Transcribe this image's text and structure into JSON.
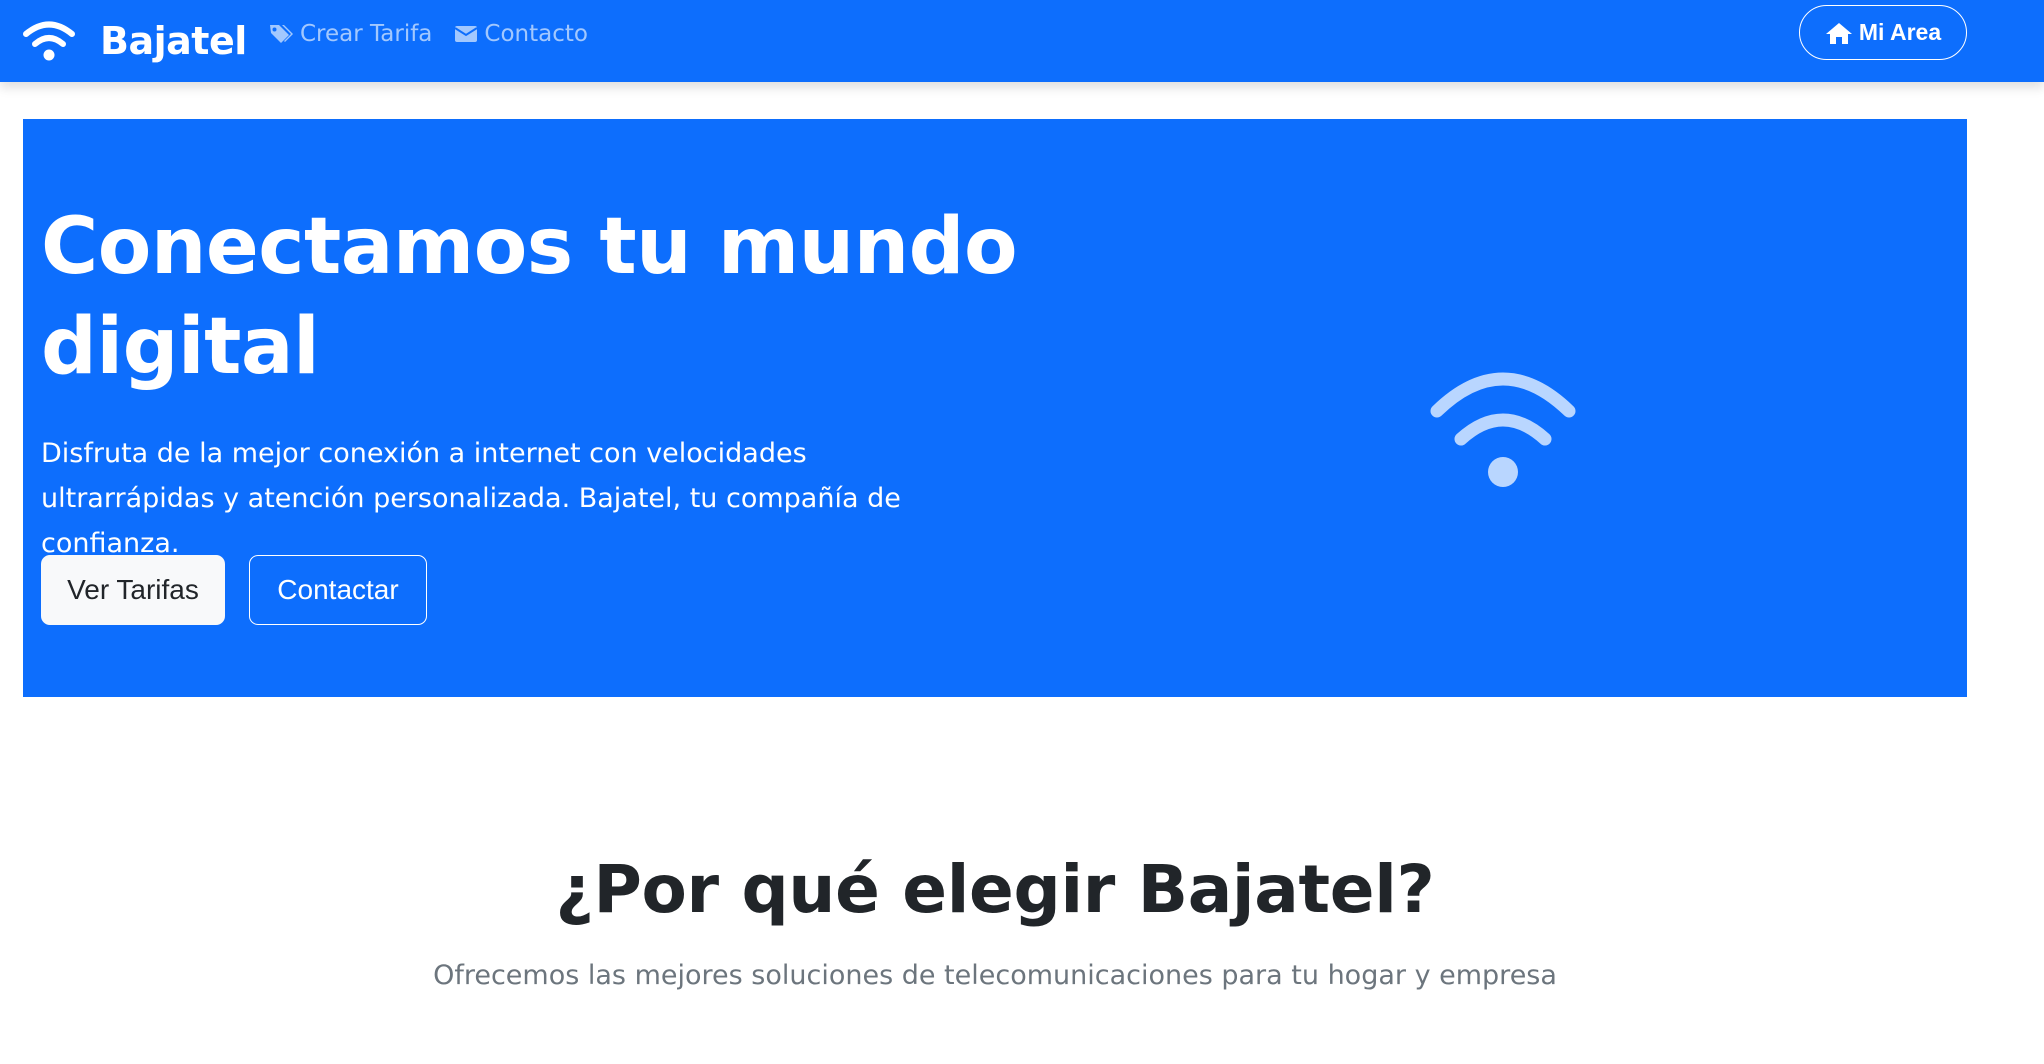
{
  "navbar": {
    "brand": "Bajatel",
    "brand_icon": "wifi-icon",
    "links": [
      {
        "label": "Crear Tarifa",
        "icon": "tags-icon"
      },
      {
        "label": "Contacto",
        "icon": "envelope-icon"
      }
    ],
    "area_button": {
      "label": "Mi Area",
      "icon": "home-icon"
    }
  },
  "hero": {
    "title": "Conectamos tu mundo digital",
    "description": "Disfruta de la mejor conexión a internet con velocidades ultrarrápidas y atención personalizada. Bajatel, tu compañía de confianza.",
    "primary_button": "Ver Tarifas",
    "secondary_button": "Contactar",
    "illustration_icon": "wifi-icon"
  },
  "why": {
    "title": "¿Por qué elegir Bajatel?",
    "subtitle": "Ofrecemos las mejores soluciones de telecomunicaciones para tu hogar y empresa"
  },
  "colors": {
    "primary": "#0d6efd",
    "light": "#f8f9fa",
    "heading": "#212529",
    "muted": "#6c757d"
  }
}
